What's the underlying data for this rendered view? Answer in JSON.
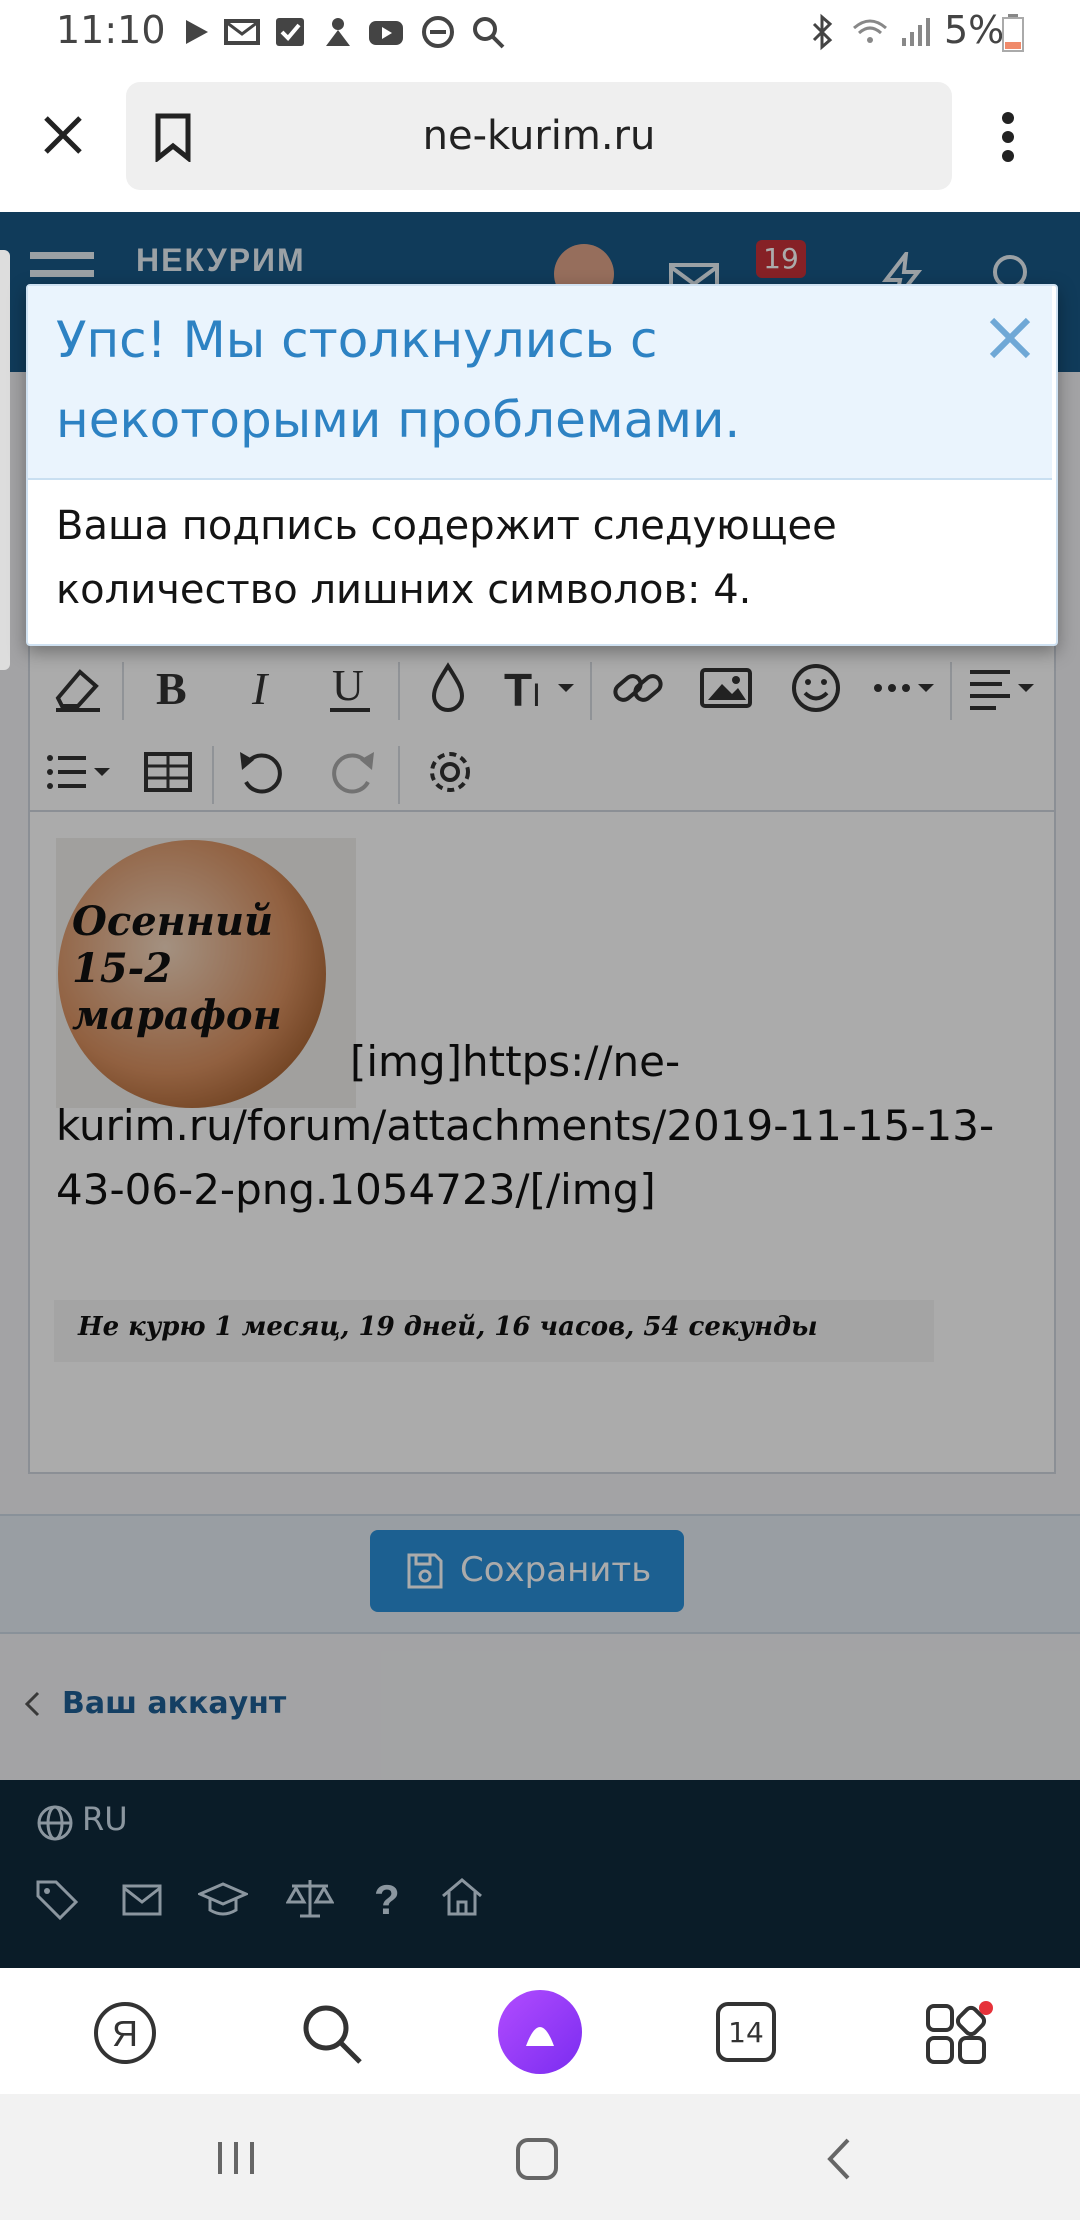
{
  "status_bar": {
    "time": "11:10",
    "battery": "5%"
  },
  "browser": {
    "url": "ne-kurim.ru"
  },
  "site": {
    "logo": "НЕКУРИМ",
    "notifications_count": "19"
  },
  "modal": {
    "title": "Упс! Мы столкнулись с некоторыми проблемами.",
    "message": "Ваша подпись содержит следующее количество лишних символов: 4."
  },
  "editor": {
    "content_text": "[img]https://ne-kurim.ru/forum/attachments/2019-11-15-13-43-06-2-png.1054723/[/img]",
    "image_caption": "Осенний 15-2 марафон",
    "signature_counter": "Не курю 1 месяц, 19 дней, 16 часов, 54 секунды"
  },
  "actions": {
    "save_label": "Сохранить"
  },
  "breadcrumb": {
    "label": "Ваш аккаунт"
  },
  "footer": {
    "language": "RU"
  },
  "bottom_nav": {
    "tabs_count": "14"
  },
  "colors": {
    "header": "#185886",
    "accent": "#2a8fd8",
    "modal_title": "#2d82c3",
    "footer": "#0f2a3d"
  }
}
